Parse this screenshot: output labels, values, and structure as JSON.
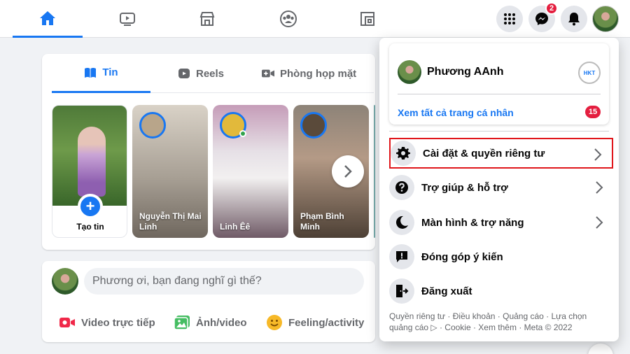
{
  "nav": {
    "tabs": [
      {
        "name": "home-icon",
        "active": true
      },
      {
        "name": "watch-icon",
        "active": false
      },
      {
        "name": "marketplace-icon",
        "active": false
      },
      {
        "name": "groups-icon",
        "active": false
      },
      {
        "name": "gaming-icon",
        "active": false
      }
    ],
    "messenger_badge": "2"
  },
  "stories": {
    "tabs": [
      "Tin",
      "Reels",
      "Phòng họp mặt"
    ],
    "create_label": "Tạo tin",
    "items": [
      {
        "name": "Nguyễn Thị Mai Linh"
      },
      {
        "name": "Linh Êê"
      },
      {
        "name": "Phạm Bình Minh"
      }
    ]
  },
  "composer": {
    "placeholder": "Phương ơi, bạn đang nghĩ gì thế?",
    "actions": [
      "Video trực tiếp",
      "Ảnh/video",
      "Feeling/activity"
    ]
  },
  "menu": {
    "profile_name": "Phương AAnh",
    "see_all": "Xem tất cả trang cá nhân",
    "see_all_badge": "15",
    "profile_logo_text": "HKT",
    "items": [
      {
        "label": "Cài đặt & quyền riêng tư",
        "icon": "gear-icon",
        "has_arrow": true,
        "highlighted": true
      },
      {
        "label": "Trợ giúp & hỗ trợ",
        "icon": "help-icon",
        "has_arrow": true
      },
      {
        "label": "Màn hình & trợ năng",
        "icon": "moon-icon",
        "has_arrow": true
      },
      {
        "label": "Đóng góp ý kiến",
        "icon": "feedback-icon",
        "has_arrow": false
      },
      {
        "label": "Đăng xuất",
        "icon": "logout-icon",
        "has_arrow": false
      }
    ],
    "footer": "Quyền riêng tư · Điều khoản · Quảng cáo · Lựa chọn quảng cáo ▷ · Cookie · Xem thêm · Meta © 2022"
  },
  "colors": {
    "accent": "#1877f2",
    "badge": "#e41e3f",
    "highlight_border": "#e0161b"
  }
}
